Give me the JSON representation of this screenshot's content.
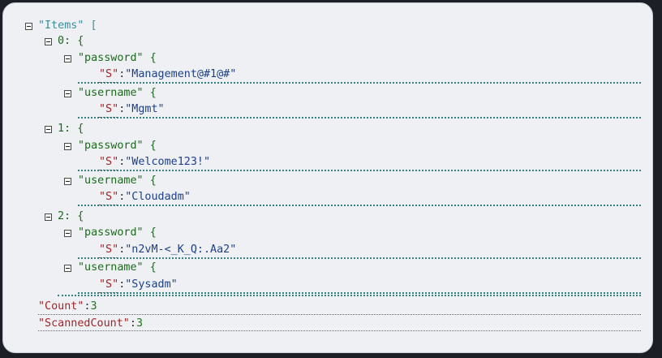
{
  "tree": {
    "root_key": "\"Items\"",
    "root_open": "[",
    "items": [
      {
        "index": "0:",
        "brace": "{",
        "fields": [
          {
            "name": "\"password\"",
            "brace": "{",
            "type": "\"S\"",
            "sep": ":",
            "value": "\"Management@#1@#\""
          },
          {
            "name": "\"username\"",
            "brace": "{",
            "type": "\"S\"",
            "sep": ":",
            "value": "\"Mgmt\""
          }
        ]
      },
      {
        "index": "1:",
        "brace": "{",
        "fields": [
          {
            "name": "\"password\"",
            "brace": "{",
            "type": "\"S\"",
            "sep": ":",
            "value": "\"Welcome123!\""
          },
          {
            "name": "\"username\"",
            "brace": "{",
            "type": "\"S\"",
            "sep": ":",
            "value": "\"Cloudadm\""
          }
        ]
      },
      {
        "index": "2:",
        "brace": "{",
        "fields": [
          {
            "name": "\"password\"",
            "brace": "{",
            "type": "\"S\"",
            "sep": ":",
            "value": "\"n2vM-<_K_Q:.Aa2\""
          },
          {
            "name": "\"username\"",
            "brace": "{",
            "type": "\"S\"",
            "sep": ":",
            "value": "\"Sysadm\""
          }
        ]
      }
    ],
    "count_key": "\"Count\"",
    "count_sep": ":",
    "count_value": "3",
    "scanned_key": "\"ScannedCount\"",
    "scanned_sep": ":",
    "scanned_value": "3"
  },
  "colors": {
    "panel_bg": "#eef0f4",
    "page_bg": "#1c1f26",
    "key_root": "#3a8f9e",
    "key_object": "#1a6b1a",
    "key_attr": "#a82424",
    "value_string": "#1c3f8e",
    "value_number": "#1a7a1a",
    "underline": "#2f7f80"
  },
  "icons": {
    "toggle": "collapse-minus-icon"
  }
}
